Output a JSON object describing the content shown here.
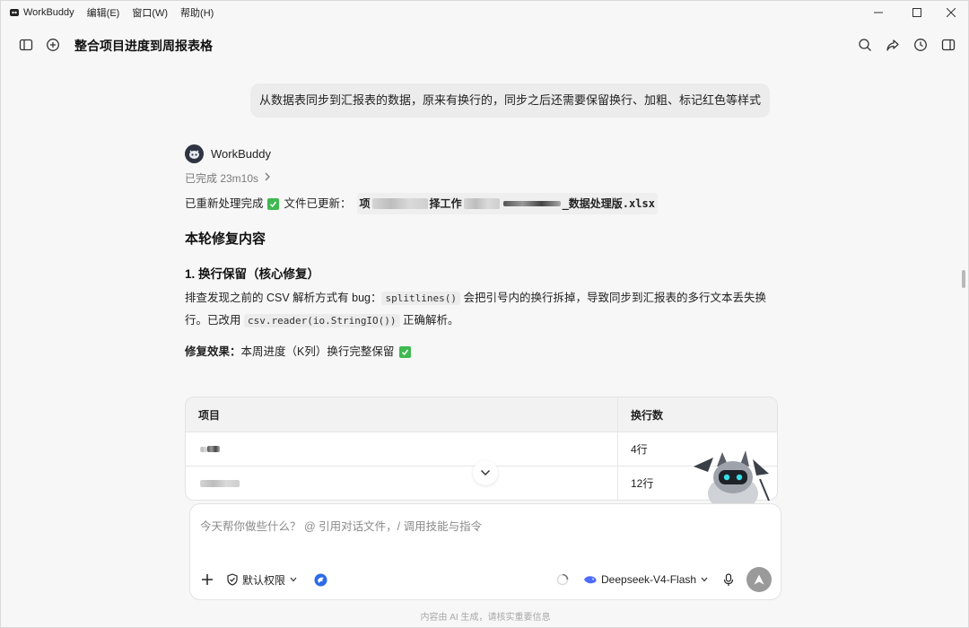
{
  "app": {
    "name": "WorkBuddy",
    "menus": [
      "编辑(E)",
      "窗口(W)",
      "帮助(H)"
    ]
  },
  "header": {
    "title": "整合项目进度到周报表格"
  },
  "conversation": {
    "user_message": "从数据表同步到汇报表的数据，原来有换行的，同步之后还需要保留换行、加粗、标记红色等样式",
    "agent_name": "WorkBuddy",
    "status": "已完成 23m10s",
    "intro_text": "已重新处理完成",
    "file_updated_label": "文件已更新：",
    "file_name_prefix": "项",
    "file_name_mid": "作",
    "file_name_suffix": "_数据处理版.xlsx",
    "section_title": "本轮修复内容",
    "subsection_title": "1. 换行保留（核心修复）",
    "para_a": "排查发现之前的 CSV 解析方式有 bug：",
    "code_a": "splitlines()",
    "para_b": " 会把引号内的换行拆掉，导致同步到汇报表的多行文本丢失换行。已改用 ",
    "code_b": "csv.reader(io.StringIO())",
    "para_c": " 正确解析。",
    "effect_label": "修复效果：",
    "effect_text": "本周进度（K列）换行完整保留"
  },
  "table": {
    "headers": [
      "项目",
      "换行数"
    ],
    "rows": [
      {
        "project": "",
        "count": "4行"
      },
      {
        "project": "",
        "count": "12行"
      }
    ]
  },
  "composer": {
    "placeholder": "今天帮你做些什么？ @ 引用对话文件，/ 调用技能与指令",
    "permission_label": "默认权限",
    "model_name": "Deepseek-V4-Flash"
  },
  "footer": {
    "note": "内容由 AI 生成，请核实重要信息"
  },
  "colors": {
    "check_green": "#3fb950",
    "bubble_bg": "#ececec",
    "accent_blue": "#2e6be6"
  }
}
